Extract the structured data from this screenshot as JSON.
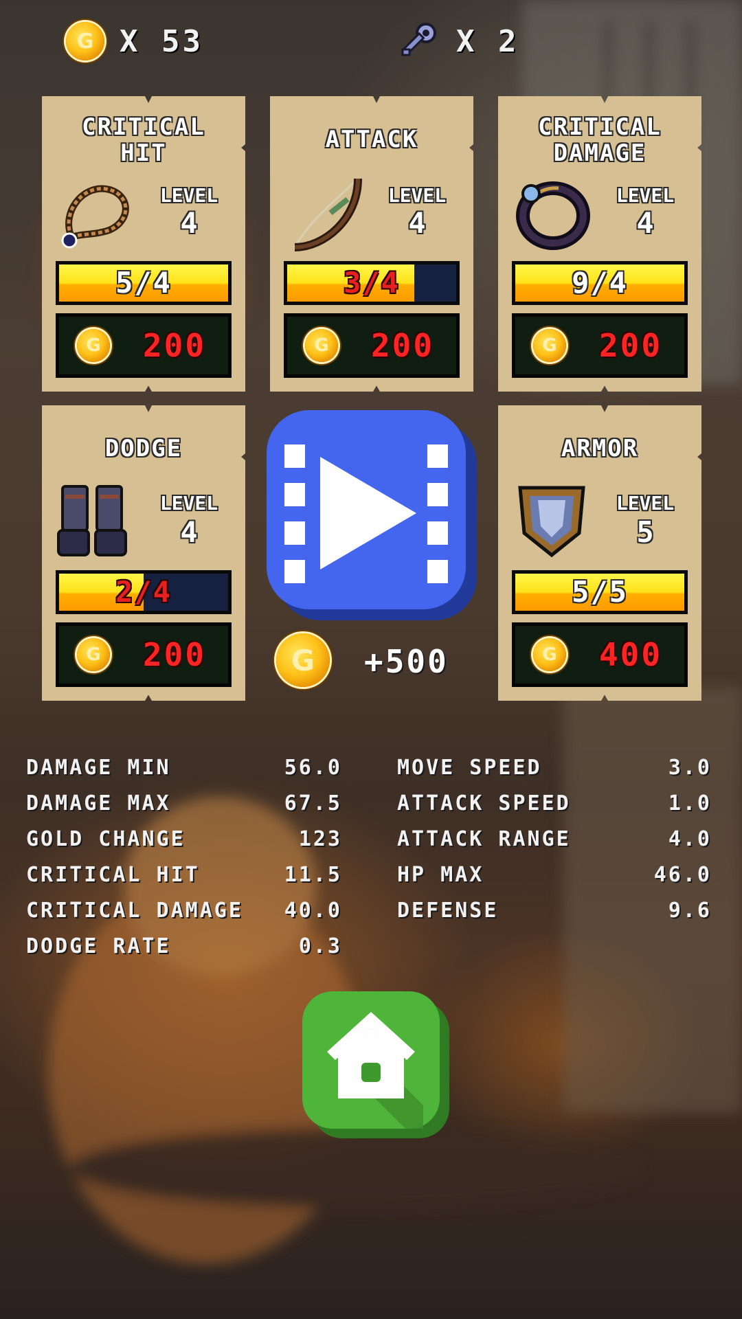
{
  "currency": {
    "coin_icon": "gold-coin-icon",
    "coins_text": "X 53",
    "key_icon": "key-icon",
    "keys_text": "X 2"
  },
  "cards": [
    {
      "title_lines": [
        "CRITICAL",
        "HIT"
      ],
      "icon": "necklace-icon",
      "level_label": "LEVEL",
      "level": "4",
      "progress_text": "5/4",
      "progress": 1.0,
      "price": "200"
    },
    {
      "title_lines": [
        "ATTACK"
      ],
      "icon": "bow-icon",
      "level_label": "LEVEL",
      "level": "4",
      "progress_text": "3/4",
      "progress": 0.75,
      "price": "200"
    },
    {
      "title_lines": [
        "CRITICAL",
        "DAMAGE"
      ],
      "icon": "ring-icon",
      "level_label": "LEVEL",
      "level": "4",
      "progress_text": "9/4",
      "progress": 1.0,
      "price": "200"
    },
    {
      "title_lines": [
        "DODGE"
      ],
      "icon": "gauntlets-icon",
      "level_label": "LEVEL",
      "level": "4",
      "progress_text": "2/4",
      "progress": 0.5,
      "price": "200"
    },
    {
      "title_lines": [
        "ARMOR"
      ],
      "icon": "shield-icon",
      "level_label": "LEVEL",
      "level": "5",
      "progress_text": "5/5",
      "progress": 1.0,
      "price": "400"
    }
  ],
  "video_reward": {
    "icon": "video-play-icon",
    "reward_text": "+500"
  },
  "stats_left": [
    {
      "label": "DAMAGE MIN",
      "value": "56.0"
    },
    {
      "label": "DAMAGE MAX",
      "value": "67.5"
    },
    {
      "label": "GOLD CHANGE",
      "value": "123"
    },
    {
      "label": "CRITICAL HIT",
      "value": "11.5"
    },
    {
      "label": "CRITICAL DAMAGE",
      "value": "40.0"
    },
    {
      "label": "DODGE RATE",
      "value": "0.3"
    }
  ],
  "stats_right": [
    {
      "label": "MOVE SPEED",
      "value": "3.0"
    },
    {
      "label": "ATTACK SPEED",
      "value": "1.0"
    },
    {
      "label": "ATTACK RANGE",
      "value": "4.0"
    },
    {
      "label": "HP MAX",
      "value": "46.0"
    },
    {
      "label": "DEFENSE",
      "value": "9.6"
    }
  ],
  "home": {
    "icon": "home-icon"
  },
  "colors": {
    "card_bg": "#d6bf93",
    "progress_full": "#ffe21a",
    "price_text": "#ff2424",
    "video_button": "#4466ee",
    "home_button": "#4fb43a"
  }
}
